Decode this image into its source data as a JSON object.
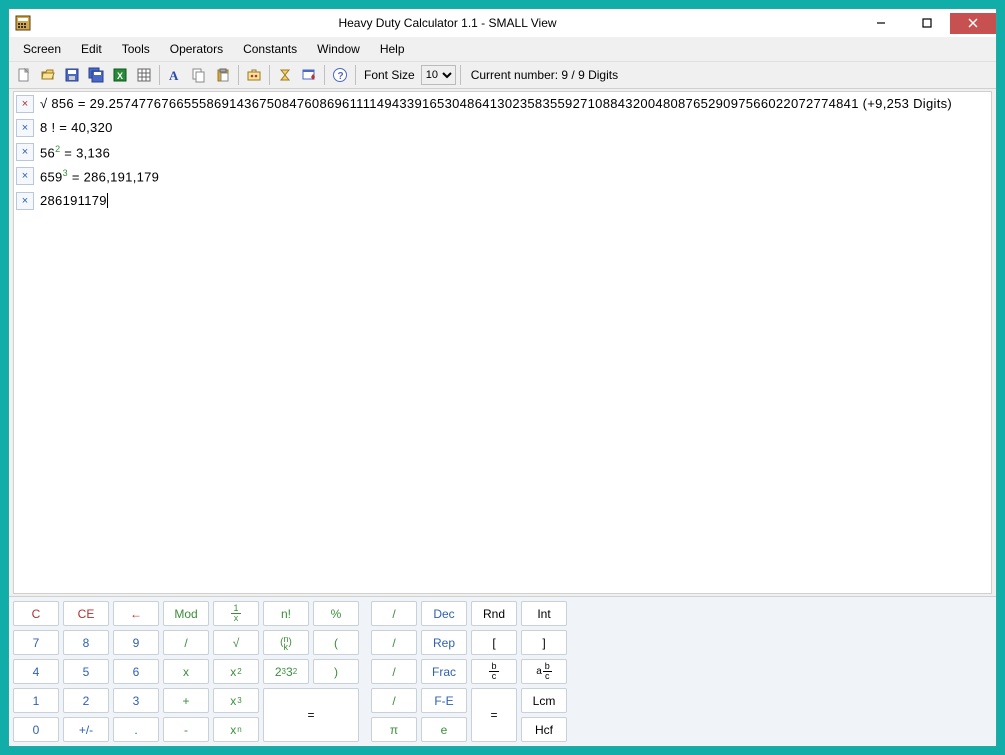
{
  "window": {
    "title": "Heavy Duty Calculator 1.1 - SMALL View"
  },
  "menu": {
    "items": [
      "Screen",
      "Edit",
      "Tools",
      "Operators",
      "Constants",
      "Window",
      "Help"
    ]
  },
  "toolbar": {
    "font_size_label": "Font Size",
    "font_size_value": "10",
    "status": "Current number: 9 / 9 Digits"
  },
  "history": [
    {
      "del_style": "red",
      "text": "√ 856 = 29.25747767665558691436750847608696111149433916530486413023583559271088432004808765290975660220727748​41 (+9,253 Digits)"
    },
    {
      "del_style": "blue",
      "text": "8 ! = 40,320"
    },
    {
      "del_style": "blue",
      "html": "56<sup class=\"sup-green\">2</sup> = 3,136"
    },
    {
      "del_style": "blue",
      "html": "659<sup class=\"sup-green\">3</sup> = 286,191,179"
    },
    {
      "del_style": "blue",
      "text": "286191179",
      "is_current": true
    }
  ],
  "keypad": {
    "left": [
      [
        {
          "label": "C",
          "cls": "c-red",
          "name": "key-clear"
        },
        {
          "label": "CE",
          "cls": "c-red",
          "name": "key-clear-entry"
        },
        {
          "label": "←",
          "cls": "c-red",
          "name": "key-backspace"
        },
        {
          "label": "Mod",
          "cls": "c-green",
          "name": "key-mod"
        },
        {
          "type": "frac",
          "num": "1",
          "den": "x",
          "cls": "c-green",
          "name": "key-reciprocal"
        },
        {
          "label": "n!",
          "cls": "c-green",
          "name": "key-factorial"
        },
        {
          "label": "%",
          "cls": "c-green",
          "name": "key-percent"
        }
      ],
      [
        {
          "label": "7",
          "cls": "c-blue",
          "name": "key-7"
        },
        {
          "label": "8",
          "cls": "c-blue",
          "name": "key-8"
        },
        {
          "label": "9",
          "cls": "c-blue",
          "name": "key-9"
        },
        {
          "label": "/",
          "cls": "c-green",
          "name": "key-divide"
        },
        {
          "label": "√",
          "cls": "c-green",
          "name": "key-sqrt"
        },
        {
          "type": "binom",
          "cls": "c-green",
          "name": "key-binomial"
        },
        {
          "label": "(",
          "cls": "c-green",
          "name": "key-paren-open"
        }
      ],
      [
        {
          "label": "4",
          "cls": "c-blue",
          "name": "key-4"
        },
        {
          "label": "5",
          "cls": "c-blue",
          "name": "key-5"
        },
        {
          "label": "6",
          "cls": "c-blue",
          "name": "key-6"
        },
        {
          "label": "x",
          "cls": "c-green",
          "name": "key-multiply"
        },
        {
          "type": "pow",
          "base": "x",
          "exp": "2",
          "cls": "c-green",
          "name": "key-square"
        },
        {
          "label": "2³3²",
          "cls": "c-green",
          "name": "key-prime-factor",
          "type": "pf"
        },
        {
          "label": ")",
          "cls": "c-green",
          "name": "key-paren-close"
        }
      ],
      [
        {
          "label": "1",
          "cls": "c-blue",
          "name": "key-1"
        },
        {
          "label": "2",
          "cls": "c-blue",
          "name": "key-2"
        },
        {
          "label": "3",
          "cls": "c-blue",
          "name": "key-3"
        },
        {
          "label": "+",
          "cls": "c-green",
          "name": "key-add"
        },
        {
          "type": "pow",
          "base": "x",
          "exp": "3",
          "cls": "c-green",
          "name": "key-cube"
        },
        {
          "label": "=",
          "cls": "c-black",
          "name": "key-equals",
          "row_span": 2,
          "col_span": 2
        }
      ],
      [
        {
          "label": "0",
          "cls": "c-blue",
          "name": "key-0"
        },
        {
          "label": "+/-",
          "cls": "c-blue",
          "name": "key-negate"
        },
        {
          "label": ".",
          "cls": "c-blue",
          "name": "key-decimal"
        },
        {
          "label": "-",
          "cls": "c-green",
          "name": "key-subtract"
        },
        {
          "type": "pow",
          "base": "x",
          "exp": "n",
          "cls": "c-green",
          "name": "key-power-n"
        }
      ]
    ],
    "right": [
      [
        {
          "label": "/",
          "cls": "c-green",
          "name": "key-r-slash-1"
        },
        {
          "label": "Dec",
          "cls": "c-blue",
          "name": "key-dec"
        },
        {
          "label": "Rnd",
          "cls": "c-black",
          "name": "key-rnd"
        },
        {
          "label": "Int",
          "cls": "c-black",
          "name": "key-int"
        }
      ],
      [
        {
          "label": "/",
          "cls": "c-green",
          "name": "key-r-slash-2"
        },
        {
          "label": "Rep",
          "cls": "c-blue",
          "name": "key-rep"
        },
        {
          "label": "[",
          "cls": "c-black",
          "name": "key-bracket-open"
        },
        {
          "label": "]",
          "cls": "c-black",
          "name": "key-bracket-close"
        }
      ],
      [
        {
          "label": "/",
          "cls": "c-green",
          "name": "key-r-slash-3"
        },
        {
          "label": "Frac",
          "cls": "c-blue",
          "name": "key-frac"
        },
        {
          "type": "frac",
          "num": "b",
          "den": "c",
          "cls": "c-black",
          "name": "key-b-over-c"
        },
        {
          "type": "mixed",
          "cls": "c-black",
          "name": "key-a-b-over-c"
        }
      ],
      [
        {
          "label": "/",
          "cls": "c-green",
          "name": "key-r-slash-4"
        },
        {
          "label": "F-E",
          "cls": "c-blue",
          "name": "key-f-e"
        },
        {
          "label": "=",
          "cls": "c-black",
          "name": "key-r-equals",
          "row_span": 2
        },
        {
          "label": "Lcm",
          "cls": "c-black",
          "name": "key-lcm"
        }
      ],
      [
        {
          "label": "π",
          "cls": "c-green",
          "name": "key-pi"
        },
        {
          "label": "e",
          "cls": "c-green",
          "name": "key-e"
        },
        null,
        {
          "label": "Hcf",
          "cls": "c-black",
          "name": "key-hcf"
        }
      ]
    ]
  }
}
